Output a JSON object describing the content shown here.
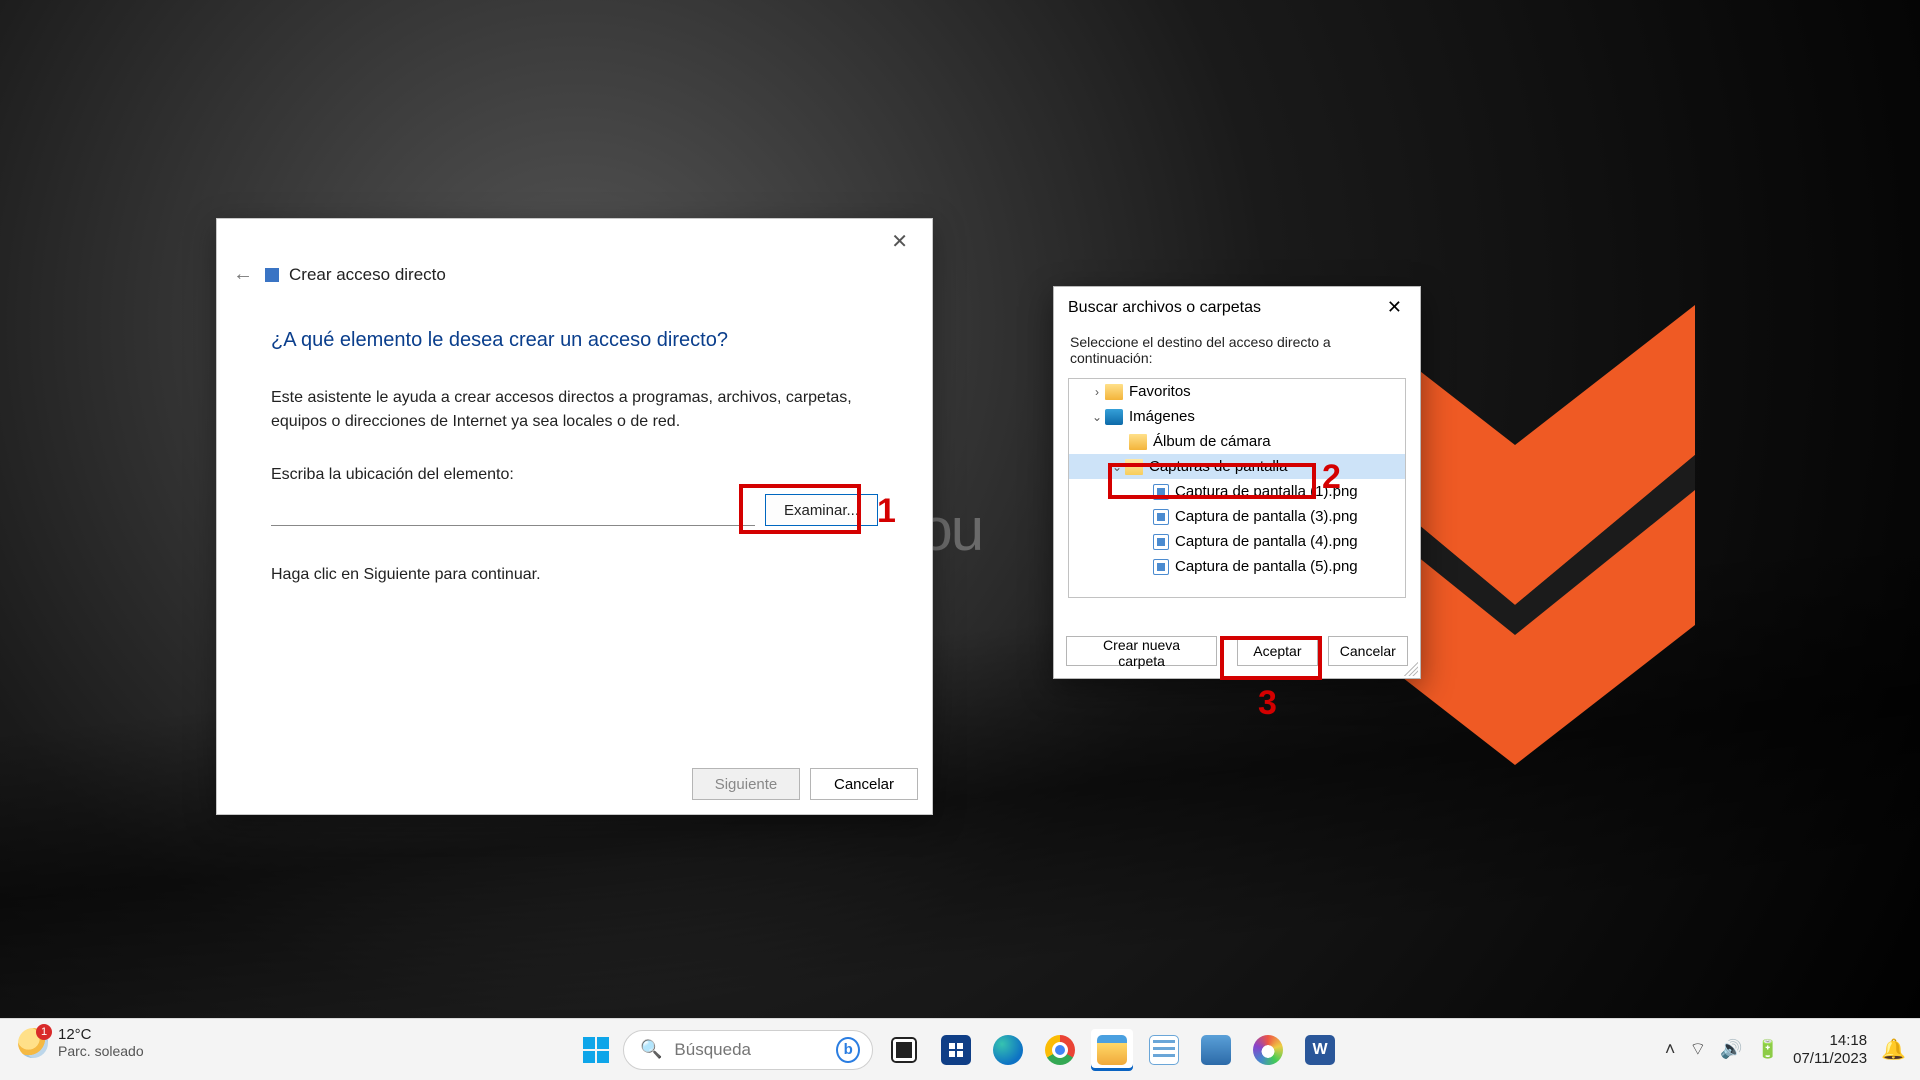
{
  "annotations": {
    "n1": "1",
    "n2": "2",
    "n3": "3"
  },
  "wallpaper_text_fragment": "lsou",
  "wizard": {
    "title": "Crear acceso directo",
    "heading": "¿A qué elemento le desea crear un acceso directo?",
    "description": "Este asistente le ayuda a crear accesos directos a programas, archivos, carpetas, equipos o direcciones de Internet ya sea locales o de red.",
    "path_label": "Escriba la ubicación del elemento:",
    "path_value": "",
    "browse_btn": "Examinar...",
    "hint": "Haga clic en Siguiente para continuar.",
    "next_btn": "Siguiente",
    "cancel_btn": "Cancelar"
  },
  "browse": {
    "title": "Buscar archivos o carpetas",
    "instruction": "Seleccione el destino del acceso directo a continuación:",
    "new_folder_btn": "Crear nueva carpeta",
    "ok_btn": "Aceptar",
    "cancel_btn": "Cancelar",
    "tree": {
      "favoritos": "Favoritos",
      "imagenes": "Imágenes",
      "album": "Álbum de cámara",
      "capturas": "Capturas de pantalla",
      "files": [
        "Captura de pantalla (1).png",
        "Captura de pantalla (3).png",
        "Captura de pantalla (4).png",
        "Captura de pantalla (5).png"
      ]
    }
  },
  "taskbar": {
    "weather": {
      "badge": "1",
      "temp": "12°C",
      "desc": "Parc. soleado"
    },
    "search_placeholder": "Búsqueda",
    "tray": {
      "time": "14:18",
      "date": "07/11/2023"
    }
  }
}
